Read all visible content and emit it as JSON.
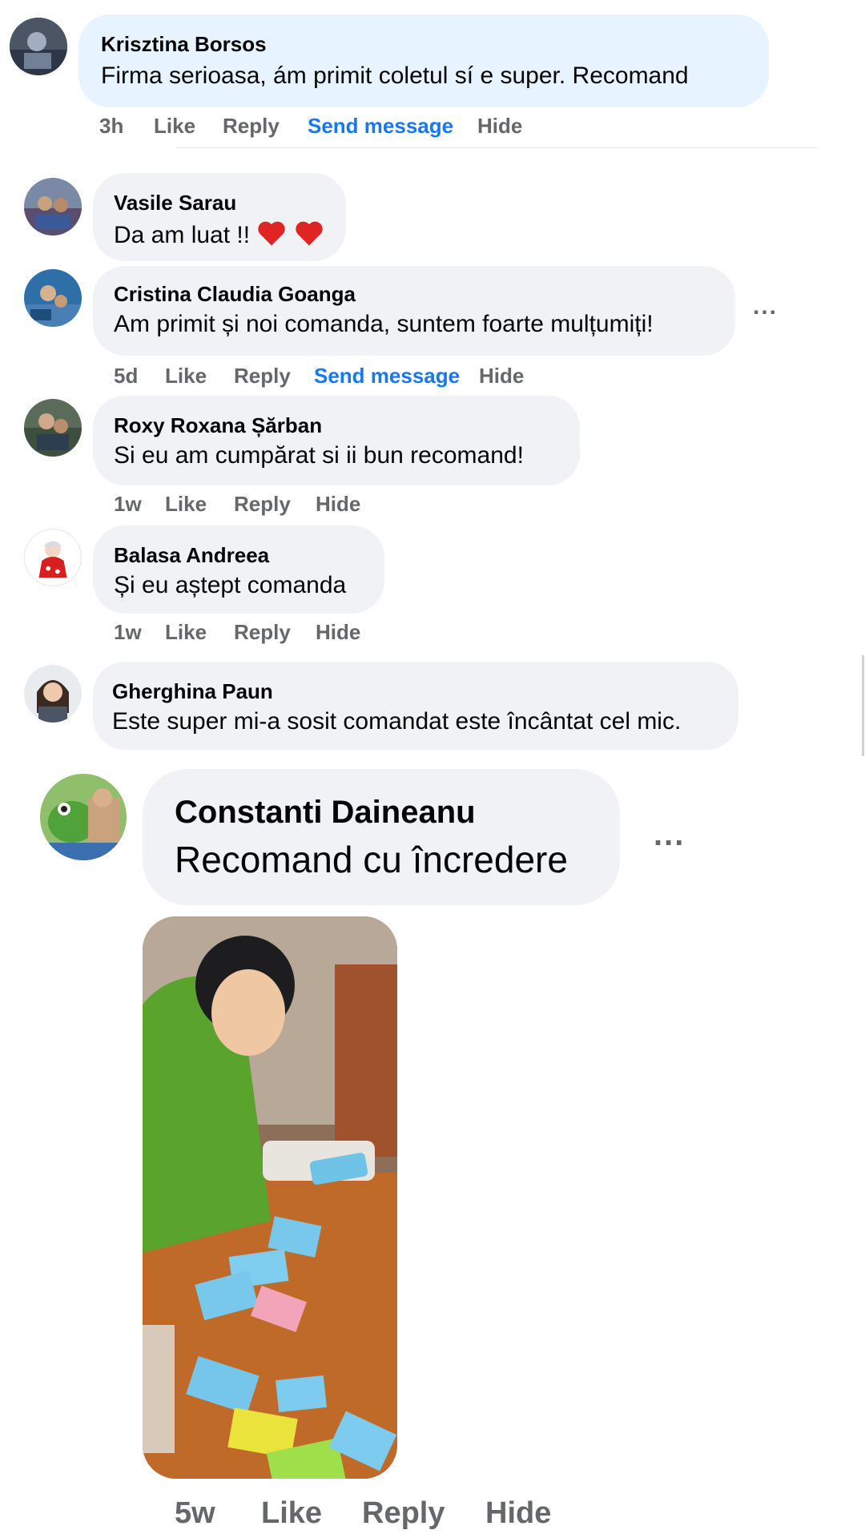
{
  "comments": [
    {
      "name": "Krisztina Borsos",
      "text": "Firma serioasa, ám primit coletul sí e super. Recomand",
      "time": "3h",
      "like": "Like",
      "reply": "Reply",
      "send_message": "Send message",
      "hide": "Hide"
    },
    {
      "name": "Vasile Sarau",
      "text": "Da am luat !!"
    },
    {
      "name": "Cristina Claudia Goanga",
      "text": "Am primit și noi comanda, suntem foarte mulțumiți!",
      "time": "5d",
      "like": "Like",
      "reply": "Reply",
      "send_message": "Send message",
      "hide": "Hide"
    },
    {
      "name": "Roxy Roxana Șărban",
      "text": "Si eu am cumpărat si ii bun recomand!",
      "time": "1w",
      "like": "Like",
      "reply": "Reply",
      "hide": "Hide"
    },
    {
      "name": "Balasa Andreea",
      "text": "Și eu aștept comanda",
      "time": "1w",
      "like": "Like",
      "reply": "Reply",
      "hide": "Hide"
    },
    {
      "name": "Gherghina Paun",
      "text": "Este super mi-a sosit comandat este încântat cel mic."
    },
    {
      "name": "Constanti Daineanu",
      "text": "Recomand cu încredere",
      "time": "5w",
      "like": "Like",
      "reply": "Reply",
      "hide": "Hide"
    }
  ],
  "more_label": "...",
  "colors": {
    "bubble": "#f0f2f5",
    "bubble_highlight": "#e7f3ff",
    "link": "#1877f2",
    "meta": "#65676b",
    "heart": "#e02424"
  }
}
